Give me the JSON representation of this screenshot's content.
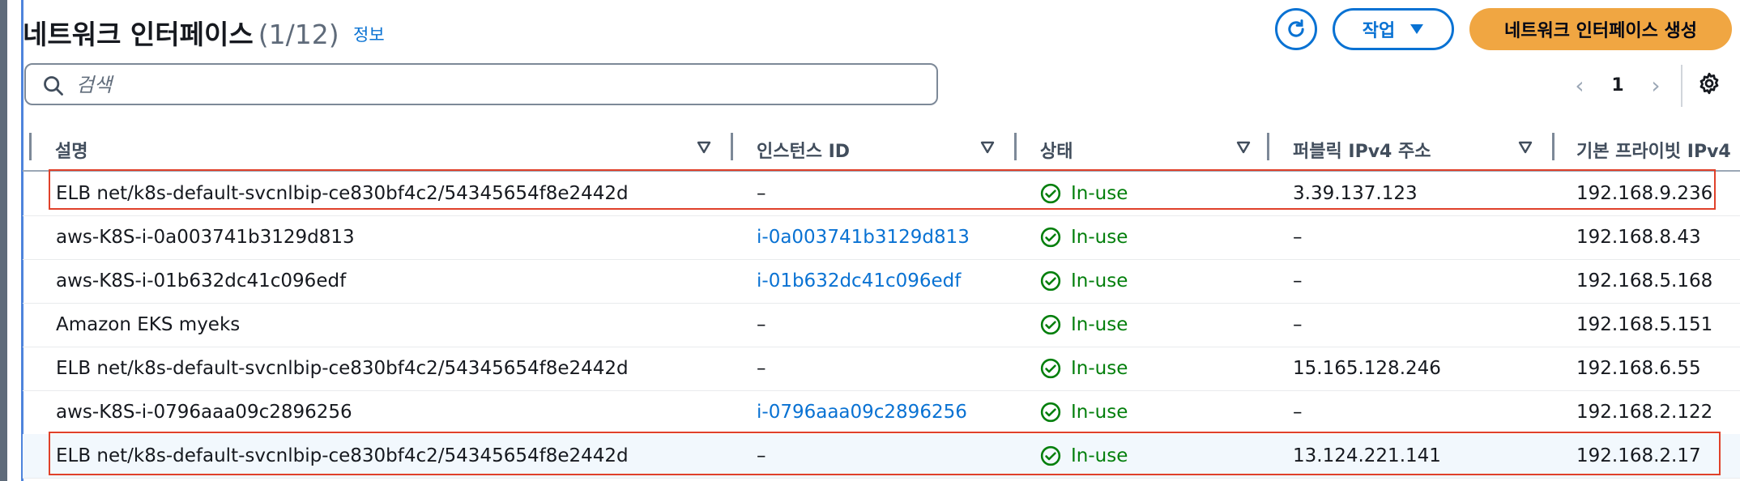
{
  "header": {
    "title": "네트워크 인터페이스",
    "count": "(1/12)",
    "info_link": "정보",
    "refresh_icon": "refresh-icon",
    "actions_label": "작업",
    "create_label": "네트워크 인터페이스 생성"
  },
  "search": {
    "placeholder": "검색",
    "value": ""
  },
  "pagination": {
    "prev_icon": "chevron-left-icon",
    "page": "1",
    "next_icon": "chevron-right-icon"
  },
  "settings_icon": "gear-icon",
  "colors": {
    "accent": "#0972d3",
    "primary_button": "#f0a642",
    "status_ok": "#037f0c",
    "highlight_box": "#e0412a",
    "selected_row": "#f2f8fd"
  },
  "table": {
    "columns": [
      "설명",
      "인스턴스 ID",
      "상태",
      "퍼블릭 IPv4 주소",
      "기본 프라이빗 IPv4"
    ],
    "rows": [
      {
        "description": "ELB net/k8s-default-svcnlbip-ce830bf4c2/54345654f8e2442d",
        "instance_id": "–",
        "status": "In-use",
        "public_ip": "3.39.137.123",
        "private_ip": "192.168.9.236",
        "instance_link": false
      },
      {
        "description": "aws-K8S-i-0a003741b3129d813",
        "instance_id": "i-0a003741b3129d813",
        "status": "In-use",
        "public_ip": "–",
        "private_ip": "192.168.8.43",
        "instance_link": true
      },
      {
        "description": "aws-K8S-i-01b632dc41c096edf",
        "instance_id": "i-01b632dc41c096edf",
        "status": "In-use",
        "public_ip": "–",
        "private_ip": "192.168.5.168",
        "instance_link": true
      },
      {
        "description": "Amazon EKS myeks",
        "instance_id": "–",
        "status": "In-use",
        "public_ip": "–",
        "private_ip": "192.168.5.151",
        "instance_link": false
      },
      {
        "description": "ELB net/k8s-default-svcnlbip-ce830bf4c2/54345654f8e2442d",
        "instance_id": "–",
        "status": "In-use",
        "public_ip": "15.165.128.246",
        "private_ip": "192.168.6.55",
        "instance_link": false
      },
      {
        "description": "aws-K8S-i-0796aaa09c2896256",
        "instance_id": "i-0796aaa09c2896256",
        "status": "In-use",
        "public_ip": "–",
        "private_ip": "192.168.2.122",
        "instance_link": true
      },
      {
        "description": "ELB net/k8s-default-svcnlbip-ce830bf4c2/54345654f8e2442d",
        "instance_id": "–",
        "status": "In-use",
        "public_ip": "13.124.221.141",
        "private_ip": "192.168.2.17",
        "instance_link": false
      }
    ]
  }
}
